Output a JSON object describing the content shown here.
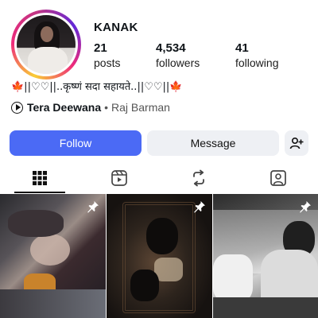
{
  "profile": {
    "username": "KANAK",
    "bio": "🍁||♡♡||..कृष्णं सदा सहायते..||♡♡||🍁"
  },
  "stats": [
    {
      "value": "21",
      "label": "posts"
    },
    {
      "value": "4,534",
      "label": "followers"
    },
    {
      "value": "41",
      "label": "following"
    }
  ],
  "music": {
    "song": "Tera Deewana",
    "separator": "•",
    "artist": "Raj Barman"
  },
  "actions": {
    "follow_label": "Follow",
    "message_label": "Message",
    "add_user_icon": "add-user-icon"
  },
  "tabs": [
    {
      "icon": "grid-icon",
      "active": true
    },
    {
      "icon": "reels-icon",
      "active": false
    },
    {
      "icon": "reposts-icon",
      "active": false
    },
    {
      "icon": "tagged-icon",
      "active": false
    }
  ],
  "posts": [
    {
      "pinned": true
    },
    {
      "pinned": true
    },
    {
      "pinned": true
    }
  ],
  "colors": {
    "follow_button": "#4b6af5",
    "secondary_button": "#eef0f4",
    "text": "#0f1419"
  }
}
